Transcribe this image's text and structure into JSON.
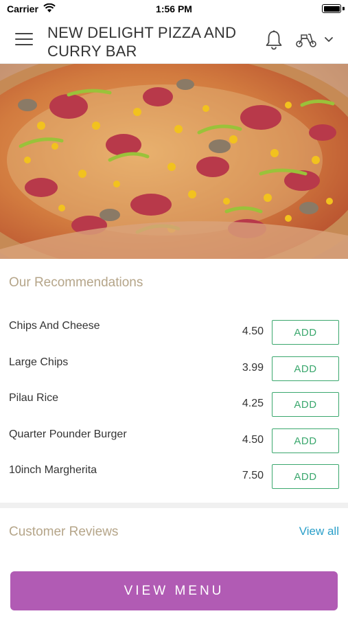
{
  "status_bar": {
    "carrier": "Carrier",
    "time": "1:56 PM"
  },
  "header": {
    "title": "NEW DELIGHT PIZZA AND CURRY BAR",
    "icons": [
      "menu-icon",
      "bell-icon",
      "scooter-icon",
      "chevron-down-icon"
    ]
  },
  "hero": {
    "image": "pizza-photo"
  },
  "recommendations": {
    "title": "Our Recommendations",
    "items": [
      {
        "name": "Chips And Cheese",
        "price": "4.50",
        "action": "ADD"
      },
      {
        "name": "Large Chips",
        "price": "3.99",
        "action": "ADD"
      },
      {
        "name": "Pilau Rice",
        "price": "4.25",
        "action": "ADD"
      },
      {
        "name": "Quarter Pounder Burger",
        "price": "4.50",
        "action": "ADD"
      },
      {
        "name": "10inch Margherita",
        "price": "7.50",
        "action": "ADD"
      }
    ]
  },
  "reviews": {
    "title": "Customer Reviews",
    "view_all": "View all"
  },
  "footer": {
    "view_menu": "VIEW MENU"
  },
  "colors": {
    "accent_purple": "#b15bb4",
    "add_green": "#3aa76d",
    "section_title": "#b5a589",
    "link_blue": "#2a9fc9"
  }
}
